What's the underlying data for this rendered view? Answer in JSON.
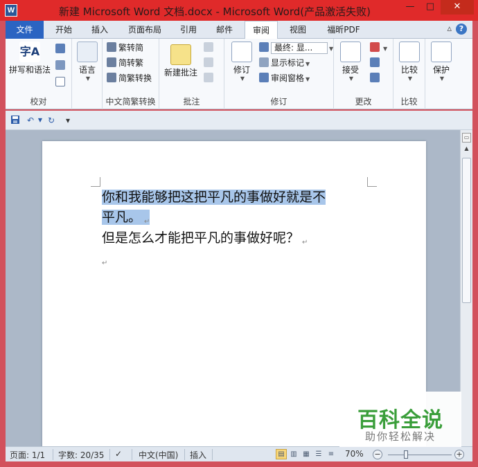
{
  "window": {
    "title": "新建 Microsoft Word 文档.docx - Microsoft Word(产品激活失败)",
    "app_icon_letter": "W",
    "controls": {
      "minimize": "—",
      "maximize": "□",
      "close": "✕"
    }
  },
  "ribbon_tabs": [
    "文件",
    "开始",
    "插入",
    "页面布局",
    "引用",
    "邮件",
    "审阅",
    "视图",
    "福昕PDF"
  ],
  "active_tab": "审阅",
  "help": {
    "collapse": "▵",
    "help": "?"
  },
  "groups": {
    "proofing": {
      "label": "校对",
      "spell_label": "拼写和语法",
      "spell_icon_text": "字A",
      "abc_text": "ABC\n123"
    },
    "language": {
      "label": "语言"
    },
    "chinese_conv": {
      "label": "中文简繁转换",
      "items": [
        "繁转简",
        "简转繁",
        "简繁转换"
      ]
    },
    "comments": {
      "label": "批注",
      "new_label": "新建批注"
    },
    "tracking": {
      "label": "修订",
      "track_label": "修订",
      "markup_mode": "最终: 显...",
      "show_markup": "显示标记",
      "review_pane": "审阅窗格"
    },
    "changes": {
      "label": "更改",
      "accept_label": "接受"
    },
    "compare": {
      "label": "比较",
      "compare_label": "比较"
    },
    "protect": {
      "label": "",
      "protect_label": "保护"
    }
  },
  "qat": {
    "save": "save",
    "undo": "↶",
    "redo": "↻",
    "customize": "▾"
  },
  "document": {
    "line1": "你和我能够把这把平凡的事做好就是不",
    "line2": "平凡。",
    "line3": "但是怎么才能把平凡的事做好呢？",
    "pmark": "↵"
  },
  "status": {
    "page": "页面: 1/1",
    "words": "字数: 20/35",
    "language": "中文(中国)",
    "mode": "插入",
    "zoom": "70%"
  },
  "watermark": {
    "title": "百科全说",
    "subtitle": "助你轻松解决"
  }
}
